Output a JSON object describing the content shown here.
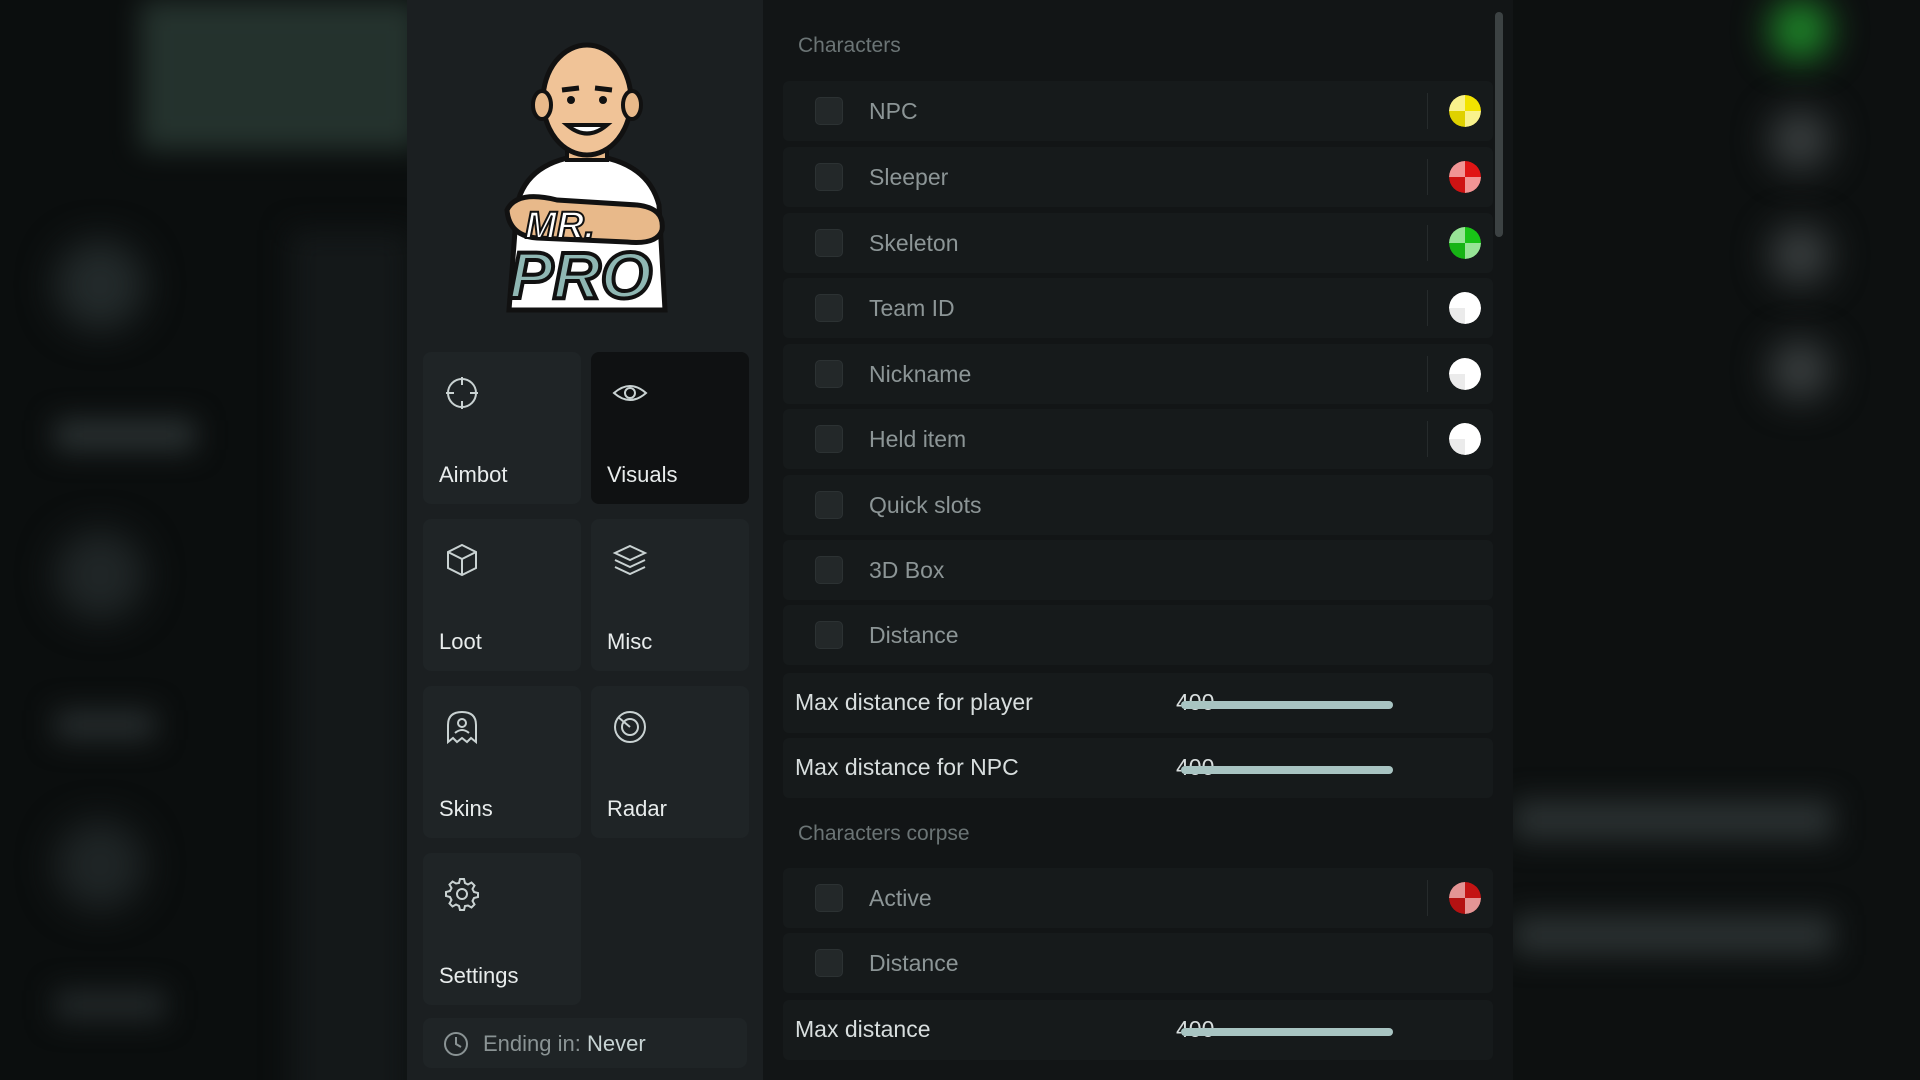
{
  "nav": {
    "items": [
      {
        "label": "Aimbot",
        "icon": "crosshair-icon",
        "active": false
      },
      {
        "label": "Visuals",
        "icon": "eye-icon",
        "active": true
      },
      {
        "label": "Loot",
        "icon": "cube-icon",
        "active": false
      },
      {
        "label": "Misc",
        "icon": "layers-icon",
        "active": false
      },
      {
        "label": "Skins",
        "icon": "ghost-icon",
        "active": false
      },
      {
        "label": "Radar",
        "icon": "radar-icon",
        "active": false
      },
      {
        "label": "Settings",
        "icon": "gear-icon",
        "active": false
      }
    ],
    "ending_label": "Ending in:",
    "ending_value": "Never"
  },
  "logo": {
    "line1": "MR.",
    "line2": "PRO"
  },
  "characters": {
    "title": "Characters",
    "options": [
      {
        "label": "NPC",
        "checked": false,
        "color": "#f2e300"
      },
      {
        "label": "Sleeper",
        "checked": false,
        "color": "#e01515"
      },
      {
        "label": "Skeleton",
        "checked": false,
        "color": "#19c417"
      },
      {
        "label": "Team ID",
        "checked": false,
        "color": "#ffffff"
      },
      {
        "label": "Nickname",
        "checked": false,
        "color": "#ffffff"
      },
      {
        "label": "Held item",
        "checked": false,
        "color": "#ffffff"
      },
      {
        "label": "Quick slots",
        "checked": false
      },
      {
        "label": "3D Box",
        "checked": false
      },
      {
        "label": "Distance",
        "checked": false
      }
    ],
    "sliders": [
      {
        "label": "Max distance for player",
        "value": "400",
        "fill": 1.0
      },
      {
        "label": "Max distance for NPC",
        "value": "400",
        "fill": 1.0
      }
    ]
  },
  "corpse": {
    "title": "Characters corpse",
    "options": [
      {
        "label": "Active",
        "checked": false,
        "color": "#c41414"
      },
      {
        "label": "Distance",
        "checked": false
      }
    ],
    "slider": {
      "label": "Max distance",
      "value": "400",
      "fill": 1.0
    }
  }
}
